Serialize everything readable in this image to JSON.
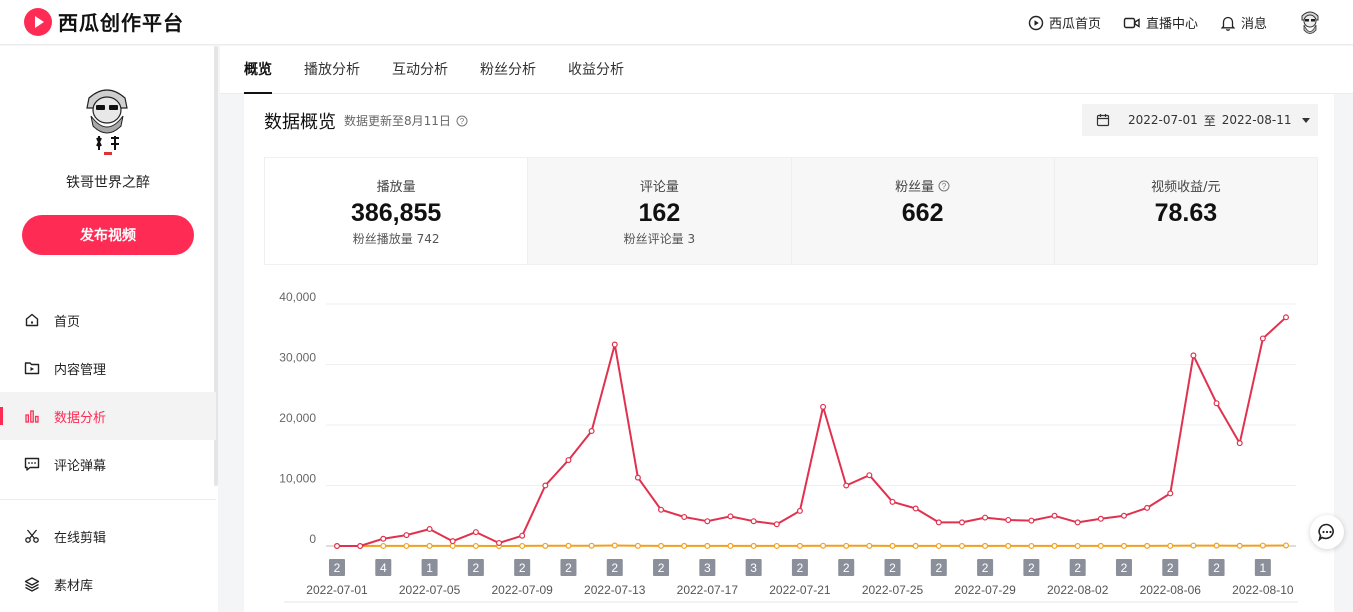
{
  "app": {
    "logo_text": "西瓜创作平台"
  },
  "topbar": {
    "links": [
      {
        "label": "西瓜首页",
        "icon": "play-circle-icon"
      },
      {
        "label": "直播中心",
        "icon": "video-camera-icon"
      },
      {
        "label": "消息",
        "icon": "bell-icon"
      }
    ]
  },
  "sidebar": {
    "user_name": "铁哥世界之醉",
    "publish_label": "发布视频",
    "items": [
      {
        "label": "首页",
        "icon": "home-icon",
        "active": false
      },
      {
        "label": "内容管理",
        "icon": "folder-play-icon",
        "active": false
      },
      {
        "label": "数据分析",
        "icon": "bar-chart-icon",
        "active": true
      },
      {
        "label": "评论弹幕",
        "icon": "comment-icon",
        "active": false
      }
    ],
    "tools": [
      {
        "label": "在线剪辑",
        "icon": "scissors-icon"
      },
      {
        "label": "素材库",
        "icon": "layers-icon"
      }
    ]
  },
  "tabs": [
    "概览",
    "播放分析",
    "互动分析",
    "粉丝分析",
    "收益分析"
  ],
  "overview": {
    "title": "数据概览",
    "updated": "数据更新至8月11日",
    "date_start": "2022-07-01",
    "date_sep": "至",
    "date_end": "2022-08-11"
  },
  "metrics": [
    {
      "label": "播放量",
      "value": "386,855",
      "sub_label": "粉丝播放量",
      "sub_value": "742",
      "active": true
    },
    {
      "label": "评论量",
      "value": "162",
      "sub_label": "粉丝评论量",
      "sub_value": "3",
      "active": false
    },
    {
      "label": "粉丝量",
      "value": "662",
      "has_help": true,
      "active": false
    },
    {
      "label": "视频收益/元",
      "value": "78.63",
      "active": false
    }
  ],
  "colors": {
    "accent": "#fe2c55",
    "line_main": "#e0324e",
    "line_fans": "#f0a020",
    "marker": "#8a8f99"
  },
  "chart_data": {
    "type": "line",
    "title": "",
    "xlabel": "",
    "ylabel": "",
    "ylim": [
      0,
      40000
    ],
    "yticks": [
      0,
      10000,
      20000,
      30000,
      40000
    ],
    "ytick_labels": [
      "0",
      "10,000",
      "20,000",
      "30,000",
      "40,000"
    ],
    "grid": true,
    "x": [
      "2022-07-01",
      "2022-07-02",
      "2022-07-03",
      "2022-07-04",
      "2022-07-05",
      "2022-07-06",
      "2022-07-07",
      "2022-07-08",
      "2022-07-09",
      "2022-07-10",
      "2022-07-11",
      "2022-07-12",
      "2022-07-13",
      "2022-07-14",
      "2022-07-15",
      "2022-07-16",
      "2022-07-17",
      "2022-07-18",
      "2022-07-19",
      "2022-07-20",
      "2022-07-21",
      "2022-07-22",
      "2022-07-23",
      "2022-07-24",
      "2022-07-25",
      "2022-07-26",
      "2022-07-27",
      "2022-07-28",
      "2022-07-29",
      "2022-07-30",
      "2022-07-31",
      "2022-08-01",
      "2022-08-02",
      "2022-08-03",
      "2022-08-04",
      "2022-08-05",
      "2022-08-06",
      "2022-08-07",
      "2022-08-08",
      "2022-08-09",
      "2022-08-10",
      "2022-08-11"
    ],
    "xtick_labels": [
      "2022-07-01",
      "2022-07-05",
      "2022-07-09",
      "2022-07-13",
      "2022-07-17",
      "2022-07-21",
      "2022-07-25",
      "2022-07-29",
      "2022-08-02",
      "2022-08-06",
      "2022-08-10"
    ],
    "series": [
      {
        "values": [
          0,
          0,
          1200,
          1800,
          2800,
          800,
          2300,
          500,
          1700,
          10000,
          14200,
          19000,
          33300,
          11300,
          6000,
          4800,
          4100,
          4900,
          4100,
          3600,
          5800,
          23000,
          10000,
          11700,
          7300,
          6200,
          3900,
          3900,
          4700,
          4300,
          4200,
          5000,
          3900,
          4500,
          5000,
          6300,
          8700,
          31500,
          23600,
          17000,
          34300,
          37800
        ]
      },
      {
        "values": [
          0,
          0,
          10,
          10,
          20,
          10,
          10,
          5,
          10,
          30,
          40,
          50,
          80,
          30,
          20,
          15,
          15,
          15,
          15,
          10,
          20,
          50,
          30,
          30,
          20,
          15,
          10,
          10,
          15,
          15,
          10,
          15,
          10,
          15,
          15,
          20,
          25,
          70,
          60,
          40,
          70,
          90
        ]
      }
    ],
    "publish_markers": [
      {
        "x": "2022-07-01",
        "count": "2"
      },
      {
        "x": "2022-07-03",
        "count": "4"
      },
      {
        "x": "2022-07-05",
        "count": "1"
      },
      {
        "x": "2022-07-07",
        "count": "2"
      },
      {
        "x": "2022-07-09",
        "count": "2"
      },
      {
        "x": "2022-07-11",
        "count": "2"
      },
      {
        "x": "2022-07-13",
        "count": "2"
      },
      {
        "x": "2022-07-15",
        "count": "2"
      },
      {
        "x": "2022-07-17",
        "count": "3"
      },
      {
        "x": "2022-07-19",
        "count": "3"
      },
      {
        "x": "2022-07-21",
        "count": "2"
      },
      {
        "x": "2022-07-23",
        "count": "2"
      },
      {
        "x": "2022-07-25",
        "count": "2"
      },
      {
        "x": "2022-07-27",
        "count": "2"
      },
      {
        "x": "2022-07-29",
        "count": "2"
      },
      {
        "x": "2022-07-31",
        "count": "2"
      },
      {
        "x": "2022-08-02",
        "count": "2"
      },
      {
        "x": "2022-08-04",
        "count": "2"
      },
      {
        "x": "2022-08-06",
        "count": "2"
      },
      {
        "x": "2022-08-08",
        "count": "2"
      },
      {
        "x": "2022-08-10",
        "count": "1"
      }
    ]
  }
}
